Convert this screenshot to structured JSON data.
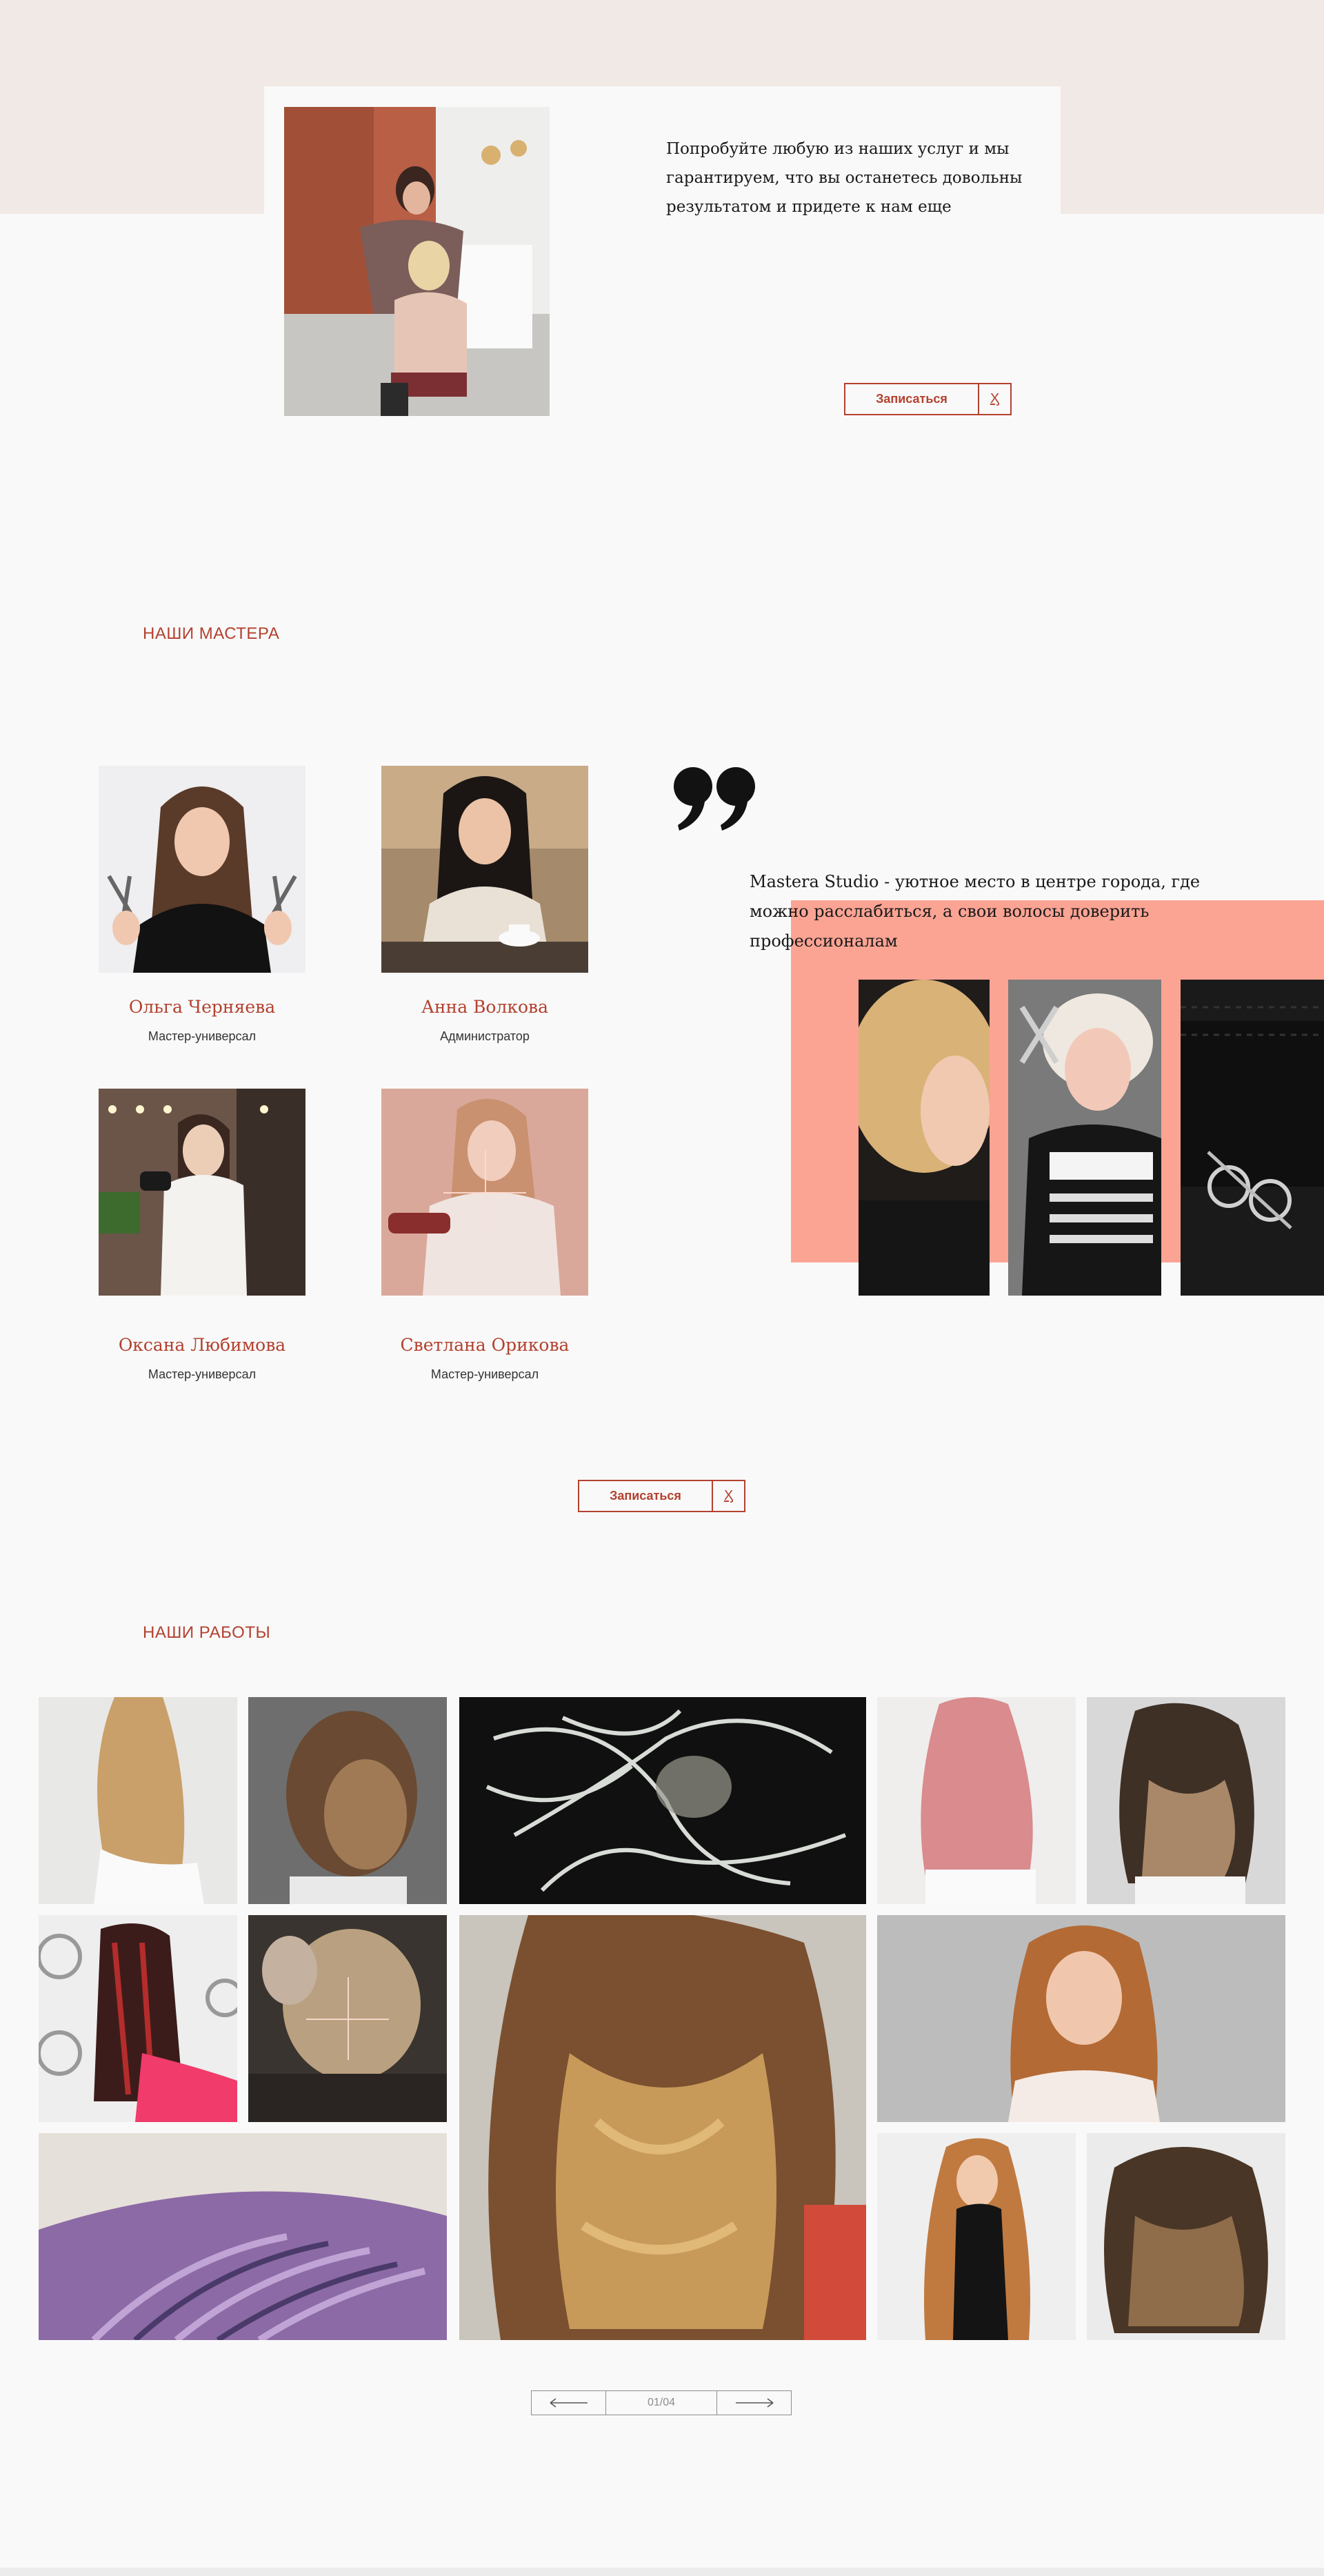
{
  "promo": {
    "text": "Попробуйте любую из наших услуг и мы гарантируем, что вы останетесь довольны результатом и придете к нам еще",
    "button_label": "Записаться",
    "button_icon": "scissors-icon"
  },
  "masters": {
    "title": "НАШИ МАСТЕРА",
    "items": [
      {
        "name": "Ольга Черняева",
        "role": "Мастер-универсал"
      },
      {
        "name": "Анна Волкова",
        "role": "Администратор"
      },
      {
        "name": "Оксана Любимова",
        "role": "Мастер-универсал"
      },
      {
        "name": "Светлана Орикова",
        "role": "Мастер-универсал"
      }
    ],
    "quote_text": "Mastera Studio - уютное место в центре города, где можно расслабиться, а свои волосы доверить профессионалам",
    "button_label": "Записаться"
  },
  "works": {
    "title": "НАШИ РАБОТЫ",
    "pager": {
      "counter": "01/04",
      "prev_icon": "arrow-left-icon",
      "next_icon": "arrow-right-icon"
    }
  },
  "colors": {
    "accent": "#b3412f",
    "salmon": "#fba494",
    "top_band": "#f1e9e5",
    "background": "#f9f9f9"
  }
}
